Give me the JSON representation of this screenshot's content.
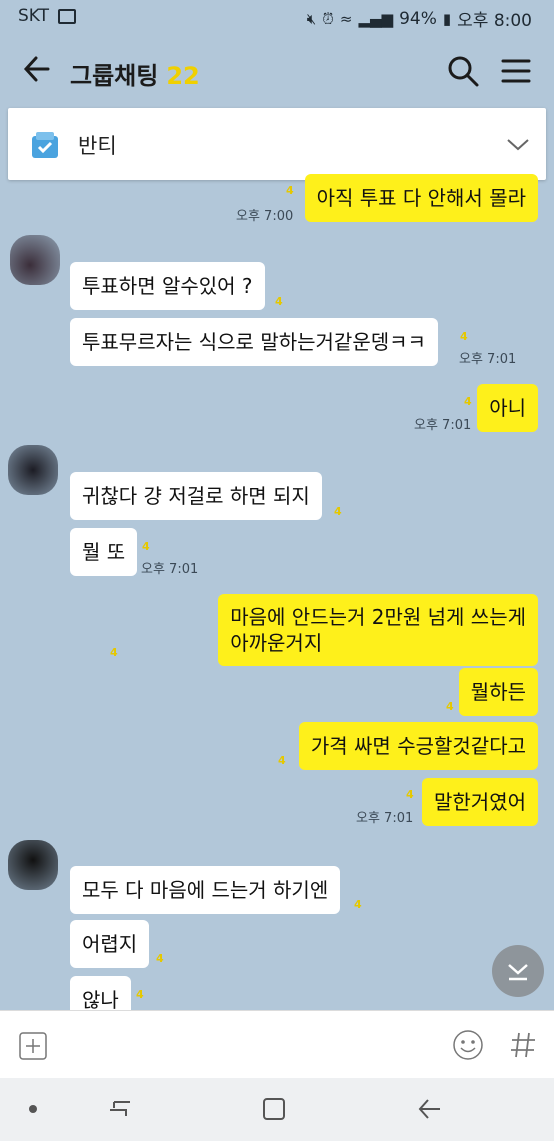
{
  "status": {
    "carrier": "SKT",
    "battery": "94%",
    "time": "오후 8:00"
  },
  "header": {
    "title": "그룹채팅",
    "count": "22"
  },
  "notice": {
    "text": "반티"
  },
  "messages": [
    {
      "side": "me",
      "text": "아직 투표 다 안해서 몰라",
      "unread": "4",
      "time": "오후 7:00"
    },
    {
      "side": "other",
      "text": "투표하면 알수있어 ?",
      "unread": "4"
    },
    {
      "side": "other",
      "text": "투표무르자는 식으로 말하는거같운뎅ㅋㅋ",
      "unread": "4",
      "time": "오후 7:01"
    },
    {
      "side": "me",
      "text": "아니",
      "unread": "4",
      "time": "오후 7:01"
    },
    {
      "side": "other",
      "text": "귀찮다 걍 저걸로 하면 되지",
      "unread": "4"
    },
    {
      "side": "other",
      "text": "뭘 또",
      "unread": "4",
      "time": "오후 7:01"
    },
    {
      "side": "me",
      "text_line1": "마음에 안드는거 2만원 넘게 쓰는게",
      "text_line2": "아까운거지",
      "unread": "4"
    },
    {
      "side": "me",
      "text": "뭘하든",
      "unread": "4"
    },
    {
      "side": "me",
      "text": "가격 싸면 수긍할것같다고",
      "unread": "4"
    },
    {
      "side": "me",
      "text": "말한거였어",
      "unread": "4",
      "time": "오후 7:01"
    },
    {
      "side": "other",
      "text": "모두 다 마음에 드는거 하기엔",
      "unread": "4"
    },
    {
      "side": "other",
      "text": "어렵지",
      "unread": "4"
    },
    {
      "side": "other",
      "text": "않나",
      "unread": "4"
    }
  ],
  "colors": {
    "background": "#b2c7d9",
    "my_bubble": "#fef01b",
    "other_bubble": "#ffffff",
    "unread": "#e5c800"
  }
}
